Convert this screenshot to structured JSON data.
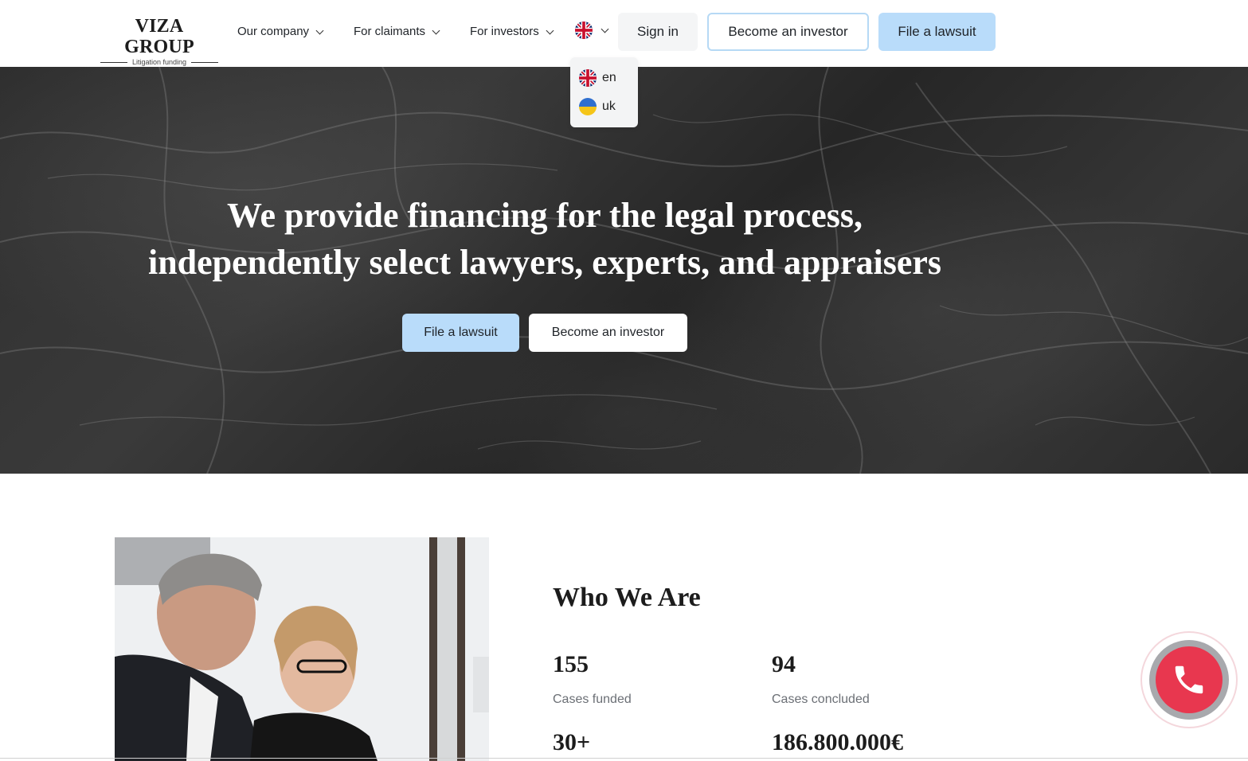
{
  "header": {
    "logo_title": "VIZA GROUP",
    "logo_subtitle": "Litigation funding",
    "nav": [
      {
        "label": "Our company"
      },
      {
        "label": "For claimants"
      },
      {
        "label": "For investors"
      }
    ],
    "sign_in": "Sign in",
    "become_investor": "Become an investor",
    "file_lawsuit": "File a lawsuit"
  },
  "language_menu": {
    "current_icon": "flag-gb-icon",
    "options": [
      {
        "code": "en",
        "icon": "flag-gb-icon"
      },
      {
        "code": "uk",
        "icon": "flag-ua-icon"
      }
    ]
  },
  "hero": {
    "title_line1": "We provide financing for the legal process,",
    "title_line2": "independently select lawyers, experts, and appraisers",
    "file_lawsuit": "File a lawsuit",
    "become_investor": "Become an investor"
  },
  "about": {
    "title": "Who We Are",
    "stats": [
      {
        "value": "155",
        "label": "Cases funded"
      },
      {
        "value": "94",
        "label": "Cases concluded"
      },
      {
        "value": "30+",
        "label": ""
      },
      {
        "value": "186.800.000€",
        "label": ""
      }
    ]
  },
  "colors": {
    "accent_blue": "#b9dcfa",
    "outline_blue": "#b6d9f5",
    "call_red": "#e8374f",
    "hero_dark": "#2f2f2f"
  },
  "call_button": {
    "icon": "phone-icon"
  }
}
